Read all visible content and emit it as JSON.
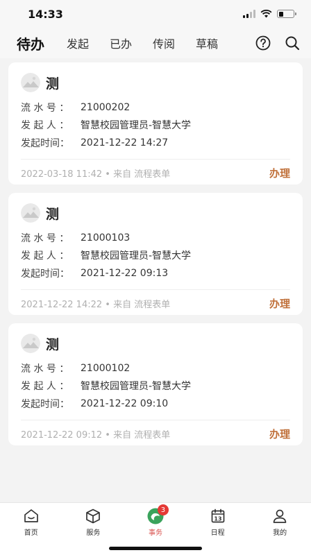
{
  "status_bar": {
    "time": "14:33",
    "battery_level": 0.3
  },
  "top_nav": {
    "tabs": [
      {
        "label": "待办",
        "active": true
      },
      {
        "label": "发起"
      },
      {
        "label": "已办"
      },
      {
        "label": "传阅"
      },
      {
        "label": "草稿"
      }
    ],
    "icons": [
      "help-circle-icon",
      "search-icon"
    ]
  },
  "labels": {
    "serial": "流 水 号 ：",
    "initiator": "发 起 人 ：",
    "time": "发起时间：",
    "handle": "办理"
  },
  "cards": [
    {
      "title": "测",
      "serial": "21000202",
      "initiator": "智慧校园管理员-智慧大学",
      "start_time": "2021-12-22 14:27",
      "footer": "2022-03-18 11:42 • 来自  流程表单"
    },
    {
      "title": "测",
      "serial": "21000103",
      "initiator": "智慧校园管理员-智慧大学",
      "start_time": "2021-12-22 09:13",
      "footer": "2021-12-22 14:22 • 来自  流程表单"
    },
    {
      "title": "测",
      "serial": "21000102",
      "initiator": "智慧校园管理员-智慧大学",
      "start_time": "2021-12-22 09:10",
      "footer": "2021-12-22 09:12 • 来自  流程表单"
    }
  ],
  "bottom_tabs": [
    {
      "label": "首页",
      "icon": "home-icon"
    },
    {
      "label": "服务",
      "icon": "cube-icon"
    },
    {
      "label": "事务",
      "icon": "task-icon",
      "active": true,
      "badge": "3"
    },
    {
      "label": "日程",
      "icon": "calendar-icon"
    },
    {
      "label": "我的",
      "icon": "user-icon"
    }
  ],
  "colors": {
    "accent": "#c0703a",
    "active_tab": "#d9534f",
    "badge": "#e53935",
    "task_icon": "#3aa35c"
  }
}
